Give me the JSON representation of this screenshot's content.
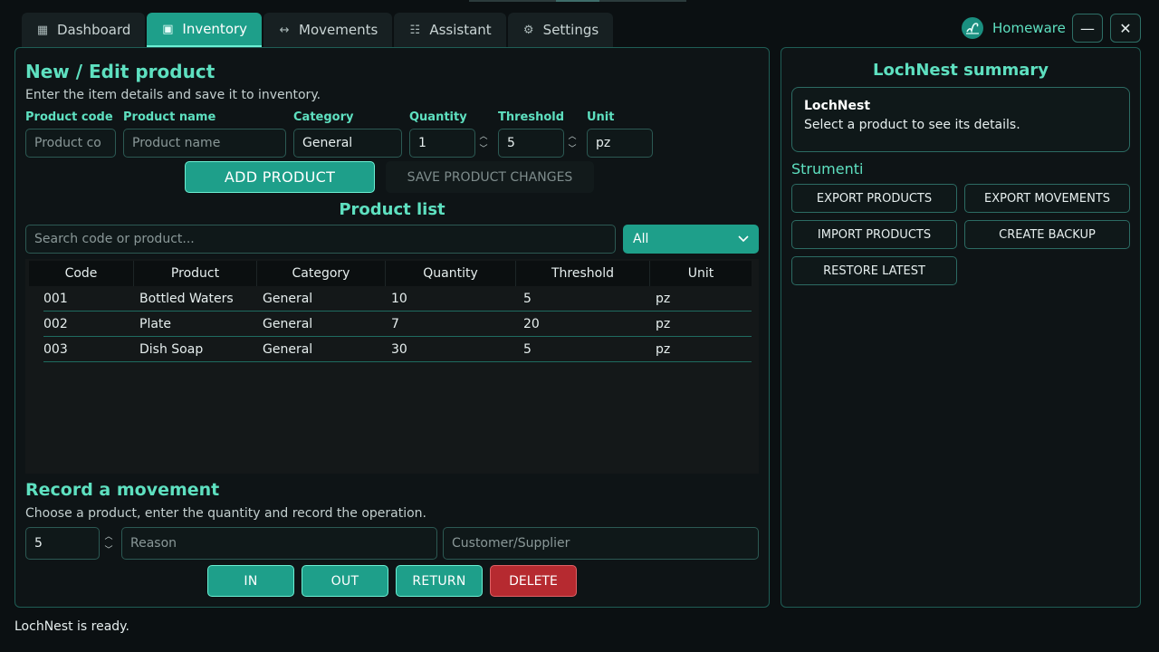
{
  "tabs": [
    {
      "label": "Dashboard",
      "icon": "grid-icon"
    },
    {
      "label": "Inventory",
      "icon": "box-icon",
      "active": true
    },
    {
      "label": "Movements",
      "icon": "arrows-icon"
    },
    {
      "label": "Assistant",
      "icon": "list-icon"
    },
    {
      "label": "Settings",
      "icon": "gear-icon"
    }
  ],
  "brand": {
    "name": "Homeware"
  },
  "window": {
    "minimize": "—",
    "close": "✕"
  },
  "product_form": {
    "title": "New / Edit product",
    "subtitle": "Enter the item details and save it to inventory.",
    "code_label": "Product code",
    "code_placeholder": "Product co",
    "name_label": "Product name",
    "name_placeholder": "Product name",
    "category_label": "Category",
    "category_value": "General",
    "quantity_label": "Quantity",
    "quantity_value": "1",
    "threshold_label": "Threshold",
    "threshold_value": "5",
    "unit_label": "Unit",
    "unit_value": "pz",
    "add_button": "ADD PRODUCT",
    "save_button": "SAVE PRODUCT CHANGES"
  },
  "product_list": {
    "title": "Product list",
    "search_placeholder": "Search code or product...",
    "filter_value": "All",
    "columns": [
      "Code",
      "Product",
      "Category",
      "Quantity",
      "Threshold",
      "Unit"
    ],
    "rows": [
      {
        "code": "001",
        "product": "Bottled Waters",
        "category": "General",
        "quantity": "10",
        "threshold": "5",
        "unit": "pz"
      },
      {
        "code": "002",
        "product": "Plate",
        "category": "General",
        "quantity": "7",
        "threshold": "20",
        "unit": "pz"
      },
      {
        "code": "003",
        "product": "Dish Soap",
        "category": "General",
        "quantity": "30",
        "threshold": "5",
        "unit": "pz"
      }
    ]
  },
  "movement": {
    "title": "Record a movement",
    "subtitle": "Choose a product, enter the quantity and record the operation.",
    "quantity_value": "5",
    "reason_placeholder": "Reason",
    "party_placeholder": "Customer/Supplier",
    "in_button": "IN",
    "out_button": "OUT",
    "return_button": "RETURN",
    "delete_button": "DELETE"
  },
  "summary": {
    "title": "LochNest summary",
    "card_title": "LochNest",
    "card_text": "Select a product to see its details."
  },
  "tools": {
    "title": "Strumenti",
    "export_products": "EXPORT PRODUCTS",
    "export_movements": "EXPORT MOVEMENTS",
    "import_products": "IMPORT PRODUCTS",
    "create_backup": "CREATE BACKUP",
    "restore_latest": "RESTORE LATEST"
  },
  "status_text": "LochNest is ready.",
  "colors": {
    "accent": "#5ee0c0",
    "primary": "#1e9f8a",
    "danger": "#b62a30",
    "background": "#0b1012"
  }
}
